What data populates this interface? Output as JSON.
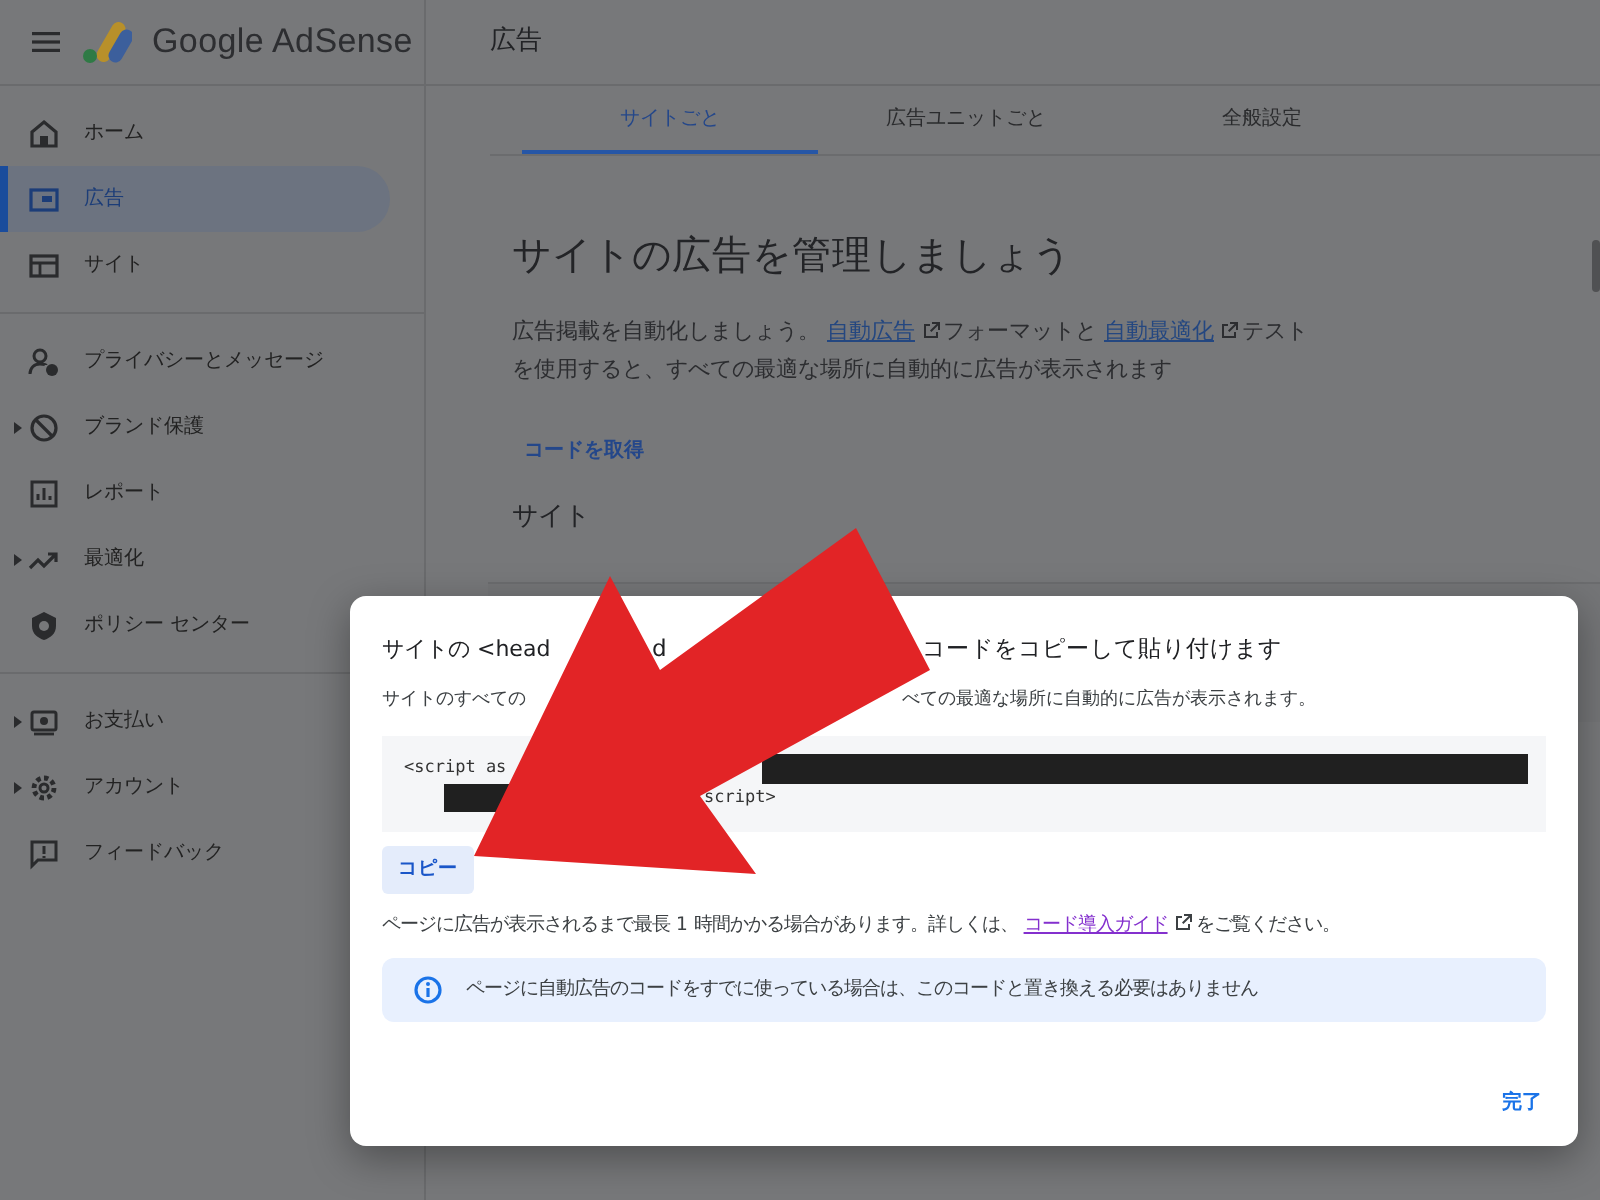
{
  "header": {
    "product": "Google AdSense",
    "page_title": "広告"
  },
  "sidebar": {
    "groups": [
      {
        "items": [
          {
            "label": "ホーム",
            "selected": false,
            "expandable": false
          },
          {
            "label": "広告",
            "selected": true,
            "expandable": false
          },
          {
            "label": "サイト",
            "selected": false,
            "expandable": false
          }
        ]
      },
      {
        "items": [
          {
            "label": "プライバシーとメッセージ",
            "selected": false,
            "expandable": false
          },
          {
            "label": "ブランド保護",
            "selected": false,
            "expandable": true
          },
          {
            "label": "レポート",
            "selected": false,
            "expandable": false
          },
          {
            "label": "最適化",
            "selected": false,
            "expandable": true
          },
          {
            "label": "ポリシー センター",
            "selected": false,
            "expandable": false
          }
        ]
      },
      {
        "items": [
          {
            "label": "お支払い",
            "selected": false,
            "expandable": true
          },
          {
            "label": "アカウント",
            "selected": false,
            "expandable": true
          },
          {
            "label": "フィードバック",
            "selected": false,
            "expandable": false
          }
        ]
      }
    ]
  },
  "tabs": [
    {
      "label": "サイトごと",
      "selected": true
    },
    {
      "label": "広告ユニットごと",
      "selected": false
    },
    {
      "label": "全般設定",
      "selected": false
    }
  ],
  "content": {
    "heading": "サイトの広告を管理しましょう",
    "intro": [
      {
        "kind": "text",
        "text": "広告掲載を自動化しましょう。 "
      },
      {
        "kind": "link",
        "text": "自動広告"
      },
      {
        "kind": "text",
        "text": "フォーマットと "
      },
      {
        "kind": "link",
        "text": "自動最適化"
      },
      {
        "kind": "text",
        "text": "テストを使用すると、すべての最適な場所に自動的に広告が表示されます"
      }
    ],
    "get_code_button": "コードを取得",
    "section_title": "サイト"
  },
  "dialog": {
    "title_parts": [
      "サイトの <head",
      "d",
      "コードをコピーして貼り付けます"
    ],
    "subtitle_parts": [
      "サイトのすべての",
      "べての最適な場所に自動的に広告が表示されます。"
    ],
    "code_lines": [
      [
        {
          "kind": "text",
          "text": "<script as"
        },
        {
          "kind": "redacted"
        }
      ],
      [
        {
          "kind": "redacted"
        },
        {
          "kind": "text",
          "text": "script>"
        }
      ]
    ],
    "copy_button": "コピー",
    "note": [
      {
        "kind": "text",
        "text": "ページに広告が表示されるまで最長 1 時間かかる場合があります。詳しくは、 "
      },
      {
        "kind": "link",
        "text": "コード導入ガイド"
      },
      {
        "kind": "text",
        "text": "をご覧ください。"
      }
    ],
    "info": "ページに自動広告のコードをすでに使っている場合は、このコードと置き換える必要はありません",
    "done_button": "完了"
  }
}
